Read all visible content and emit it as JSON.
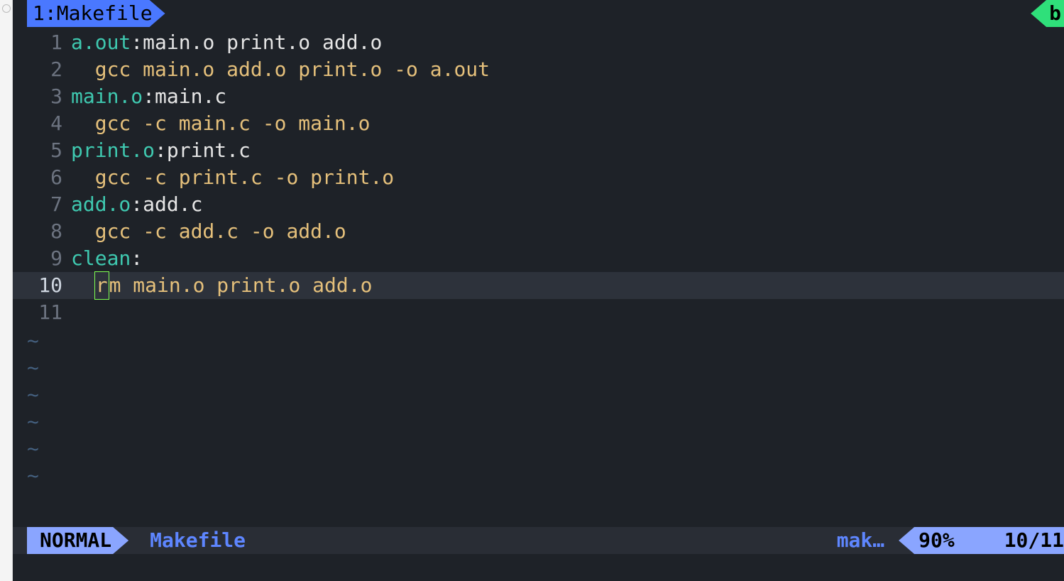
{
  "buffer_tab": {
    "index": "1",
    "label": "Makefile"
  },
  "top_right_badge": "b",
  "lines": {
    "1": {
      "no": "1",
      "target": "a.out",
      "colon": ":",
      "prereq": "main.o print.o add.o"
    },
    "2": {
      "no": "2",
      "indent": "  ",
      "cmd": "gcc main.o add.o print.o -o a.out"
    },
    "3": {
      "no": "3",
      "target": "main.o",
      "colon": ":",
      "prereq": "main.c"
    },
    "4": {
      "no": "4",
      "indent": "  ",
      "cmd": "gcc -c main.c -o main.o"
    },
    "5": {
      "no": "5",
      "target": "print.o",
      "colon": ":",
      "prereq": "print.c"
    },
    "6": {
      "no": "6",
      "indent": "  ",
      "cmd": "gcc -c print.c -o print.o"
    },
    "7": {
      "no": "7",
      "target": "add.o",
      "colon": ":",
      "prereq": "add.c"
    },
    "8": {
      "no": "8",
      "indent": "  ",
      "cmd": "gcc -c add.c -o add.o"
    },
    "9": {
      "no": "9",
      "target": "clean",
      "colon": ":"
    },
    "10": {
      "no": "10",
      "indent": "  ",
      "cur": "r",
      "rest": "m main.o print.o add.o"
    },
    "11": {
      "no": "11"
    }
  },
  "tilde": "~",
  "status": {
    "mode": "NORMAL",
    "file": "Makefile",
    "filetype": "mak…",
    "percent": "90%",
    "position": "10/11"
  }
}
